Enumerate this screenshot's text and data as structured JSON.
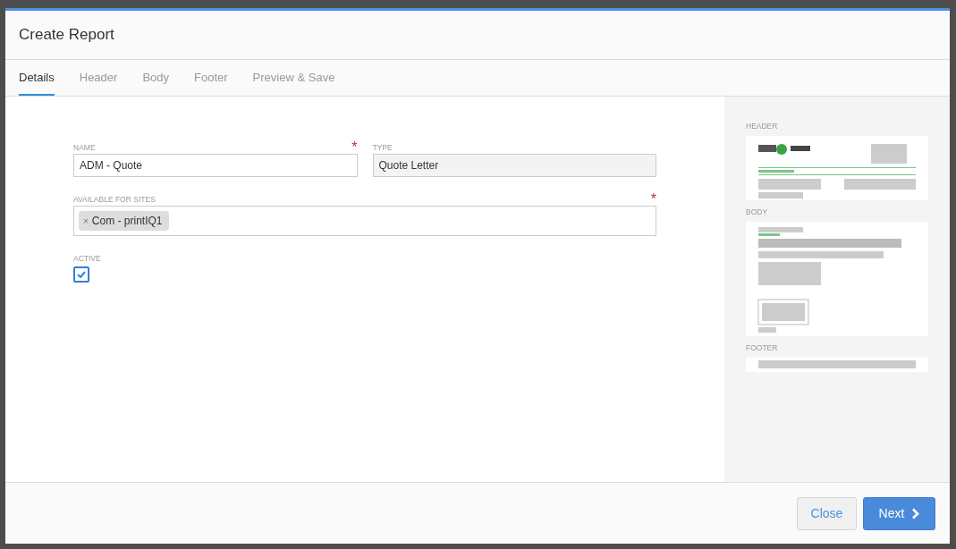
{
  "dialog": {
    "title": "Create Report"
  },
  "tabs": [
    {
      "label": "Details",
      "selected": true
    },
    {
      "label": "Header",
      "selected": false
    },
    {
      "label": "Body",
      "selected": false
    },
    {
      "label": "Footer",
      "selected": false
    },
    {
      "label": "Preview & Save",
      "selected": false
    }
  ],
  "form": {
    "name": {
      "label": "NAME",
      "required_mark": "*",
      "value": "ADM - Quote"
    },
    "type": {
      "label": "TYPE",
      "value": "Quote Letter",
      "disabled": true
    },
    "sites": {
      "label": "AVAILABLE FOR SITES",
      "required_mark": "*",
      "tags": [
        {
          "remove": "×",
          "label": "Com - printIQ1"
        }
      ]
    },
    "active": {
      "label": "ACTIVE",
      "checked": true
    }
  },
  "preview": {
    "sections": [
      {
        "label": "HEADER",
        "kind": "header"
      },
      {
        "label": "BODY",
        "kind": "body"
      },
      {
        "label": "FOOTER",
        "kind": "footer"
      }
    ]
  },
  "buttons": [
    {
      "label": "Close",
      "kind": "secondary"
    },
    {
      "label": "Next",
      "kind": "primary"
    }
  ]
}
